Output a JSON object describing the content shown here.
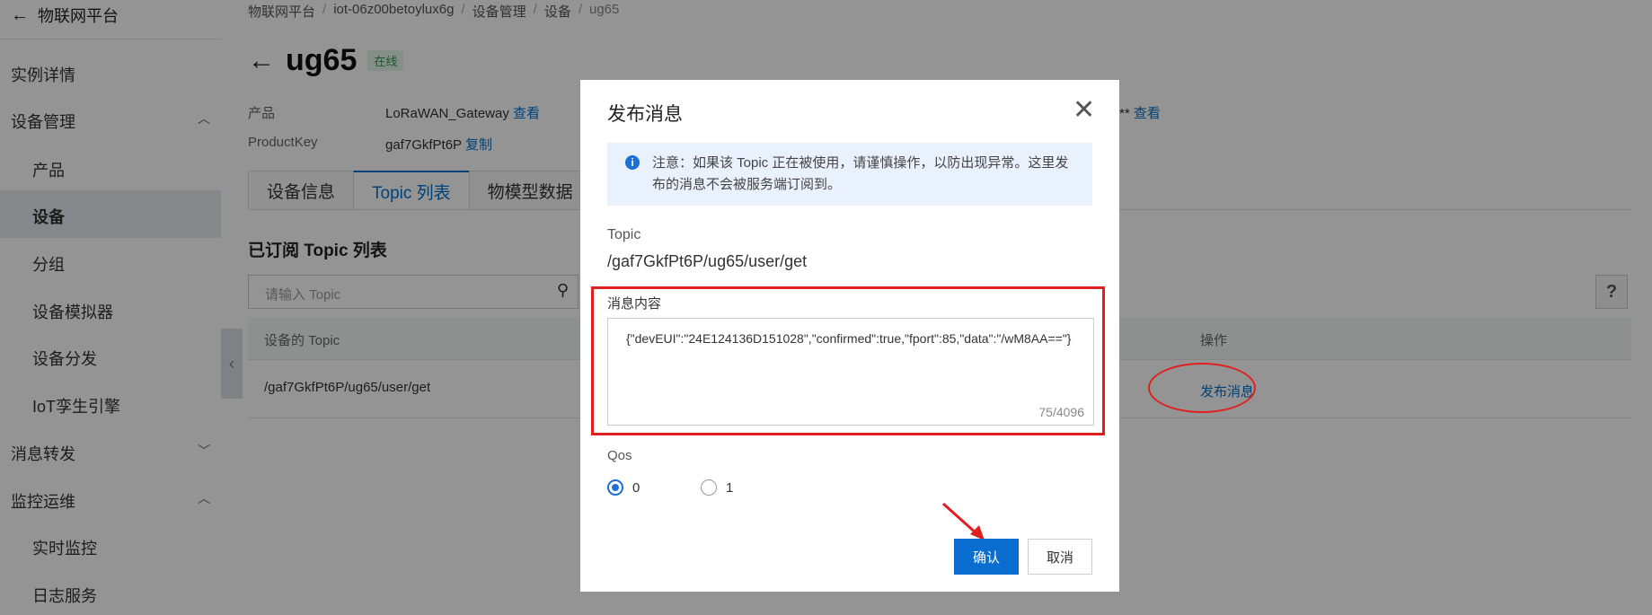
{
  "sidebar": {
    "header": "物联网平台",
    "items": [
      {
        "label": "实例详情"
      },
      {
        "label": "设备管理"
      },
      {
        "label": "产品"
      },
      {
        "label": "设备"
      },
      {
        "label": "分组"
      },
      {
        "label": "设备模拟器"
      },
      {
        "label": "设备分发"
      },
      {
        "label": "IoT孪生引擎"
      },
      {
        "label": "消息转发"
      },
      {
        "label": "监控运维"
      },
      {
        "label": "实时监控"
      },
      {
        "label": "日志服务"
      }
    ]
  },
  "breadcrumb": [
    "物联网平台",
    "iot-06z00betoylux6g",
    "设备管理",
    "设备",
    "ug65"
  ],
  "device": {
    "name": "ug65",
    "status": "在线",
    "product_label": "产品",
    "product_value": "LoRaWAN_Gateway",
    "view_link": "查看",
    "productkey_label": "ProductKey",
    "productkey_value": "gaf7GkfPt6P",
    "copy_link": "复制",
    "masked_secret": "**",
    "secret_view_link": "查看"
  },
  "tabs": [
    "设备信息",
    "Topic 列表",
    "物模型数据"
  ],
  "topic_section": {
    "title": "已订阅 Topic 列表",
    "search_placeholder": "请输入 Topic",
    "help": "?",
    "columns": [
      "设备的 Topic",
      "操作"
    ],
    "rows": [
      {
        "topic": "/gaf7GkfPt6P/ug65/user/get",
        "action": "发布消息"
      }
    ]
  },
  "modal": {
    "title": "发布消息",
    "notice": "注意：如果该 Topic 正在被使用，请谨慎操作，以防出现异常。这里发布的消息不会被服务端订阅到。",
    "topic_label": "Topic",
    "topic_value": "/gaf7GkfPt6P/ug65/user/get",
    "content_label": "消息内容",
    "content_value": "{\"devEUI\":\"24E124136D151028\",\"confirmed\":true,\"fport\":85,\"data\":\"/wM8AA==\"}",
    "char_count": "75/4096",
    "qos_label": "Qos",
    "qos_options": [
      "0",
      "1"
    ],
    "qos_selected": "0",
    "confirm_label": "确认",
    "cancel_label": "取消"
  },
  "icons": {
    "back": "arrow-left-icon",
    "close": "close-icon",
    "info": "info-icon",
    "search": "search-icon"
  },
  "colors": {
    "accent": "#0a6ed1",
    "annotation": "#e02020",
    "online": "#2e9e4a"
  }
}
